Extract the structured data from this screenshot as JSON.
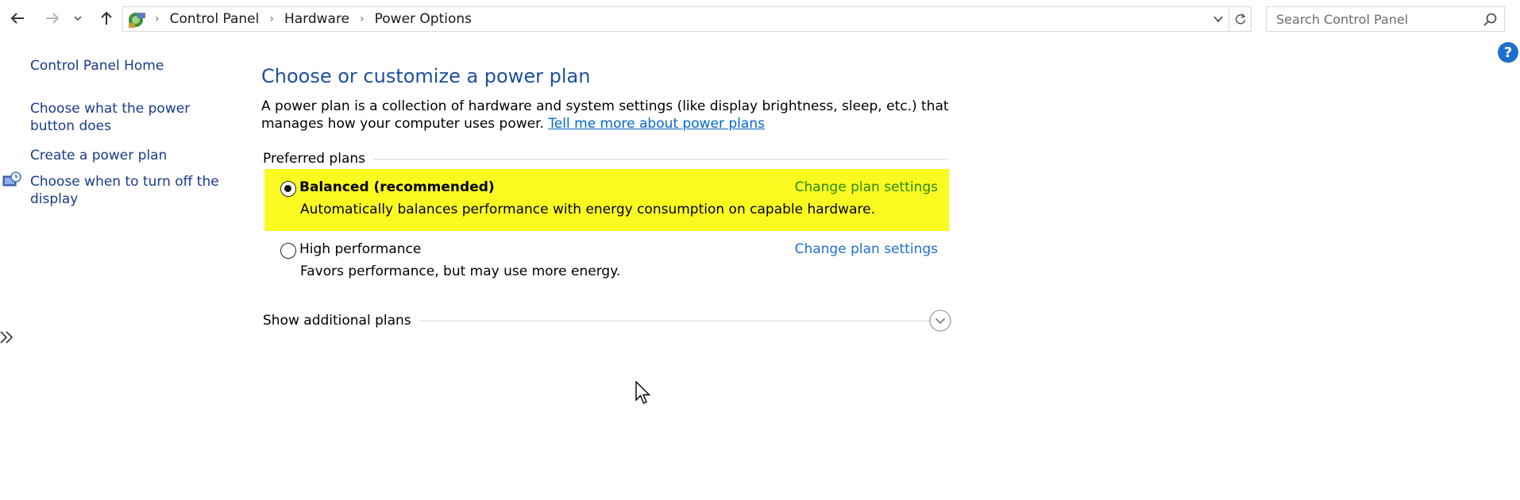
{
  "nav": {
    "back_icon": "back-arrow-icon",
    "forward_icon": "forward-arrow-icon",
    "recent_icon": "chevron-down-icon",
    "up_icon": "up-arrow-icon"
  },
  "address": {
    "icon": "control-panel-icon",
    "crumbs": [
      "Control Panel",
      "Hardware",
      "Power Options"
    ],
    "dropdown_icon": "chevron-down-icon",
    "refresh_icon": "refresh-icon"
  },
  "search": {
    "placeholder": "Search Control Panel",
    "value": "",
    "icon": "search-icon"
  },
  "help": {
    "label": "?",
    "color": "#1e6ed0"
  },
  "sidebar": {
    "items": [
      {
        "label": "Control Panel Home"
      },
      {
        "label": "Choose what the power button does"
      },
      {
        "label": "Create a power plan"
      },
      {
        "label": "Choose when to turn off the display",
        "icon": "display-clock-icon"
      }
    ],
    "collapse_icon": "double-chevron-right-icon"
  },
  "main": {
    "title": "Choose or customize a power plan",
    "intro_text": "A power plan is a collection of hardware and system settings (like display brightness, sleep, etc.) that manages how your computer uses power.",
    "intro_link": "Tell me more about power plans",
    "preferred_header": "Preferred plans",
    "plans": [
      {
        "name": "Balanced (recommended)",
        "description": "Automatically balances performance with energy consumption on capable hardware.",
        "selected": true,
        "change_label": "Change plan settings",
        "highlight_color": "#fbfa20",
        "link_color": "#2a8a12"
      },
      {
        "name": "High performance",
        "description": "Favors performance, but may use more energy.",
        "selected": false,
        "change_label": "Change plan settings",
        "link_color": "#1e6ed0"
      }
    ],
    "additional_header": "Show additional plans",
    "expand_icon": "chevron-down-circle-icon"
  },
  "colors": {
    "title": "#1e4fa0",
    "sidebar_link": "#1a3a8a",
    "link": "#0066cc"
  }
}
